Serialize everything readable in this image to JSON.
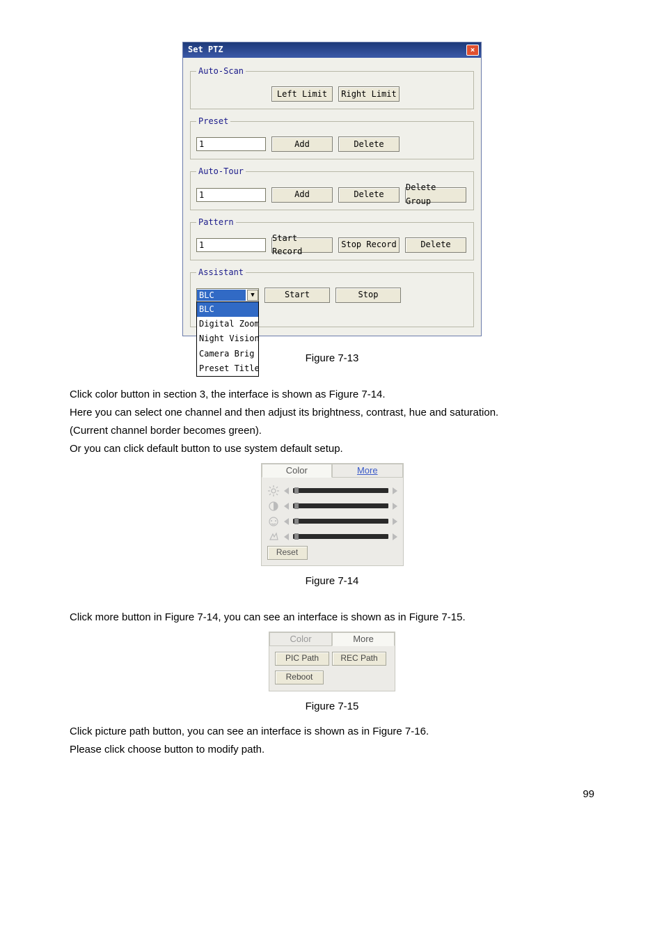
{
  "dialog": {
    "title": "Set PTZ",
    "close_icon": "×",
    "autoscan": {
      "legend": "Auto-Scan",
      "left_limit": "Left Limit",
      "right_limit": "Right Limit"
    },
    "preset": {
      "legend": "Preset",
      "value": "1",
      "add": "Add",
      "delete": "Delete"
    },
    "autotour": {
      "legend": "Auto-Tour",
      "value": "1",
      "add": "Add",
      "delete": "Delete",
      "delete_group": "Delete Group"
    },
    "pattern": {
      "legend": "Pattern",
      "value": "1",
      "start_record": "Start Record",
      "stop_record": "Stop Record",
      "delete": "Delete"
    },
    "assistant": {
      "legend": "Assistant",
      "selected": "BLC",
      "options": [
        "BLC",
        "Digital Zoom",
        "Night Vision",
        "Camera Brig",
        "Preset Title"
      ],
      "start": "Start",
      "stop": "Stop"
    }
  },
  "fig713": "Figure 7-13",
  "para1": "Click color button in section 3, the interface is shown as Figure 7-14.",
  "para2": "Here you can select one channel and then adjust its brightness, contrast, hue and saturation.",
  "para3": "(Current channel border becomes green).",
  "para4": "Or you can click default button to use system default setup.",
  "color_panel": {
    "tab_color": "Color",
    "tab_more": "More",
    "reset": "Reset"
  },
  "fig714": "Figure 7-14",
  "para5": "Click more button in Figure 7-14, you can see an interface is shown as in Figure 7-15.",
  "more_panel": {
    "tab_color": "Color",
    "tab_more": "More",
    "pic_path": "PIC Path",
    "rec_path": "REC Path",
    "reboot": "Reboot"
  },
  "fig715": "Figure 7-15",
  "para6": "Click picture path button, you can see an interface is shown as in Figure 7-16.",
  "para7": "Please click choose button to modify path.",
  "page_num": "99"
}
